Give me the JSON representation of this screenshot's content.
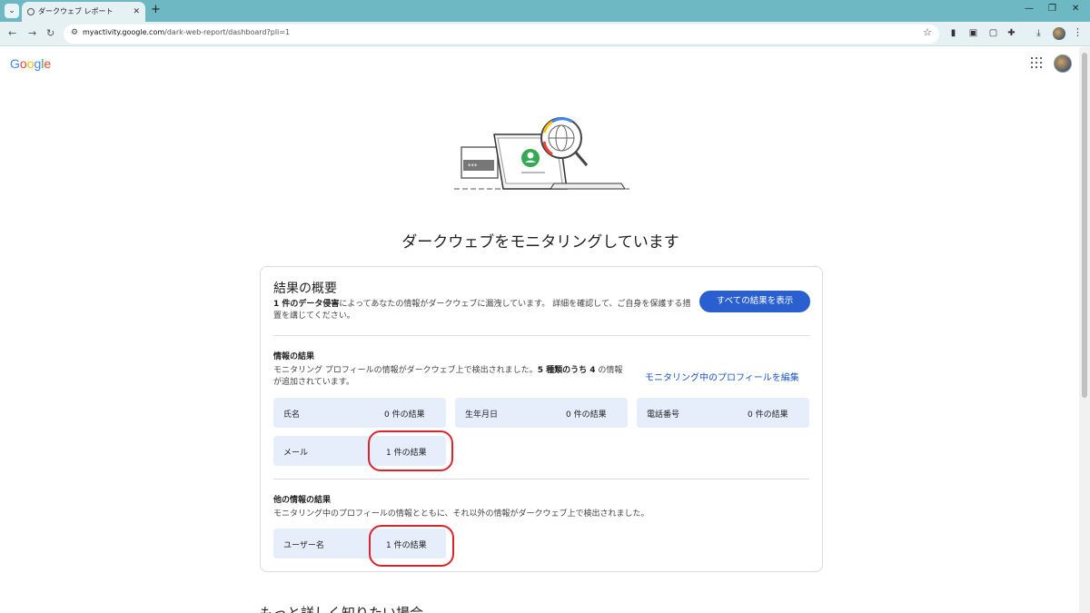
{
  "browser": {
    "tab_title": "ダークウェブ レポート",
    "url_host": "myactivity.google.com",
    "url_path": "/dark-web-report/dashboard?pli=1"
  },
  "header": {
    "logo": "Google"
  },
  "page": {
    "heading": "ダークウェブをモニタリングしています",
    "more_heading": "もっと詳しく知りたい場合"
  },
  "summary": {
    "title": "結果の概要",
    "text_bold": "1 件のデータ侵害",
    "text_rest": "によってあなたの情報がダークウェブに漏洩しています。 詳細を確認して、ご自身を保護する措置を講じてください。",
    "button": "すべての結果を表示"
  },
  "info_results": {
    "title": "情報の結果",
    "desc_pre": "モニタリング プロフィールの情報がダークウェブ上で検出されました。",
    "desc_bold": "5 種類のうち 4",
    "desc_post": " の情報が追加されています。",
    "edit_link": "モニタリング中のプロフィールを編集",
    "items": [
      {
        "label": "氏名",
        "value": "0 件の結果"
      },
      {
        "label": "生年月日",
        "value": "0 件の結果"
      },
      {
        "label": "電話番号",
        "value": "0 件の結果"
      },
      {
        "label": "メール",
        "value": "1 件の結果"
      }
    ]
  },
  "other_results": {
    "title": "他の情報の結果",
    "desc": "モニタリング中のプロフィールの情報とともに、それ以外の情報がダークウェブ上で検出されました。",
    "items": [
      {
        "label": "ユーザー名",
        "value": "1 件の結果"
      }
    ]
  },
  "colors": {
    "primary": "#2a5fcf",
    "chip": "#e6edfb",
    "annotation": "#d9242b",
    "tabbar": "#6db8c3"
  }
}
